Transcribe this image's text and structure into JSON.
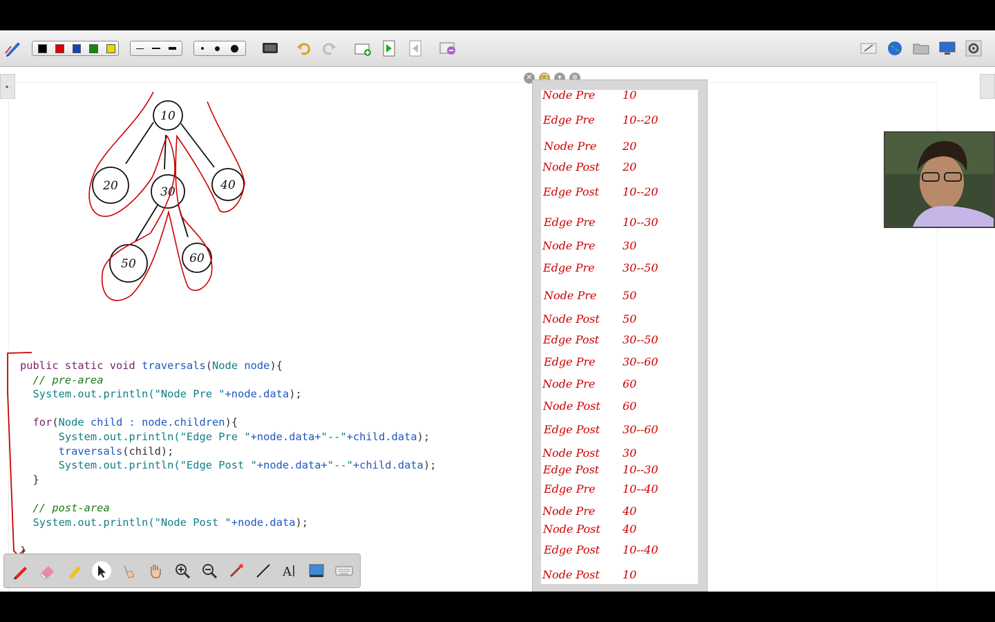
{
  "toolbar": {
    "colors": [
      "#000000",
      "#dd0000",
      "#1144bb",
      "#118811",
      "#e8d800"
    ],
    "line_widths": [
      1,
      2,
      4
    ],
    "dot_sizes": [
      4,
      7,
      11
    ]
  },
  "code": {
    "lines": [
      [
        {
          "t": "public static void ",
          "c": "kw"
        },
        {
          "t": "traversals",
          "c": "id"
        },
        {
          "t": "(",
          "c": "pn"
        },
        {
          "t": "Node",
          "c": "ty"
        },
        {
          "t": " node",
          "c": "id"
        },
        {
          "t": "){",
          "c": "pn"
        }
      ],
      [
        {
          "t": "  // pre-area",
          "c": "cm"
        }
      ],
      [
        {
          "t": "  System.out.println(",
          "c": "st"
        },
        {
          "t": "\"Node Pre \"",
          "c": "st"
        },
        {
          "t": "+node.data",
          "c": "id"
        },
        {
          "t": ");",
          "c": "pn"
        }
      ],
      [],
      [
        {
          "t": "  for",
          "c": "kw"
        },
        {
          "t": "(",
          "c": "pn"
        },
        {
          "t": "Node",
          "c": "ty"
        },
        {
          "t": " child : node.children",
          "c": "id"
        },
        {
          "t": "){",
          "c": "pn"
        }
      ],
      [
        {
          "t": "      System.out.println(",
          "c": "st"
        },
        {
          "t": "\"Edge Pre \"",
          "c": "st"
        },
        {
          "t": "+node.data+",
          "c": "id"
        },
        {
          "t": "\"--\"",
          "c": "st"
        },
        {
          "t": "+child.data",
          "c": "id"
        },
        {
          "t": ");",
          "c": "pn"
        }
      ],
      [
        {
          "t": "      traversals",
          "c": "id"
        },
        {
          "t": "(child);",
          "c": "pn"
        }
      ],
      [
        {
          "t": "      System.out.println(",
          "c": "st"
        },
        {
          "t": "\"Edge Post \"",
          "c": "st"
        },
        {
          "t": "+node.data+",
          "c": "id"
        },
        {
          "t": "\"--\"",
          "c": "st"
        },
        {
          "t": "+child.data",
          "c": "id"
        },
        {
          "t": ");",
          "c": "pn"
        }
      ],
      [
        {
          "t": "  }",
          "c": "pn"
        }
      ],
      [],
      [
        {
          "t": "  // post-area",
          "c": "cm"
        }
      ],
      [
        {
          "t": "  System.out.println(",
          "c": "st"
        },
        {
          "t": "\"Node Post \"",
          "c": "st"
        },
        {
          "t": "+node.data",
          "c": "id"
        },
        {
          "t": ");",
          "c": "pn"
        }
      ],
      [],
      [
        {
          "t": "}",
          "c": "pn"
        }
      ]
    ]
  },
  "tree": {
    "nodes": [
      "10",
      "20",
      "30",
      "40",
      "50",
      "60"
    ]
  },
  "notes": [
    {
      "label": "Node Pre",
      "value": "10"
    },
    {
      "label": "Edge Pre",
      "value": "10--20"
    },
    {
      "label": "Node Pre",
      "value": "20"
    },
    {
      "label": "Node Post",
      "value": "20"
    },
    {
      "label": "Edge Post",
      "value": "10--20"
    },
    {
      "label": "Edge Pre",
      "value": "10--30"
    },
    {
      "label": "Node Pre",
      "value": "30"
    },
    {
      "label": "Edge Pre",
      "value": "30--50"
    },
    {
      "label": "Node Pre",
      "value": "50"
    },
    {
      "label": "Node Post",
      "value": "50"
    },
    {
      "label": "Edge Post",
      "value": "30--50"
    },
    {
      "label": "Edge Pre",
      "value": "30--60"
    },
    {
      "label": "Node Pre",
      "value": "60"
    },
    {
      "label": "Node Post",
      "value": "60"
    },
    {
      "label": "Edge Post",
      "value": "30--60"
    },
    {
      "label": "Node Post",
      "value": "30"
    },
    {
      "label": "Edge Post",
      "value": "10--30"
    },
    {
      "label": "Edge Pre",
      "value": "10--40"
    },
    {
      "label": "Node Pre",
      "value": "40"
    },
    {
      "label": "Node Post",
      "value": "40"
    },
    {
      "label": "Edge Post",
      "value": "10--40"
    },
    {
      "label": "Node Post",
      "value": "10"
    }
  ],
  "ink_color": "#cc0000"
}
